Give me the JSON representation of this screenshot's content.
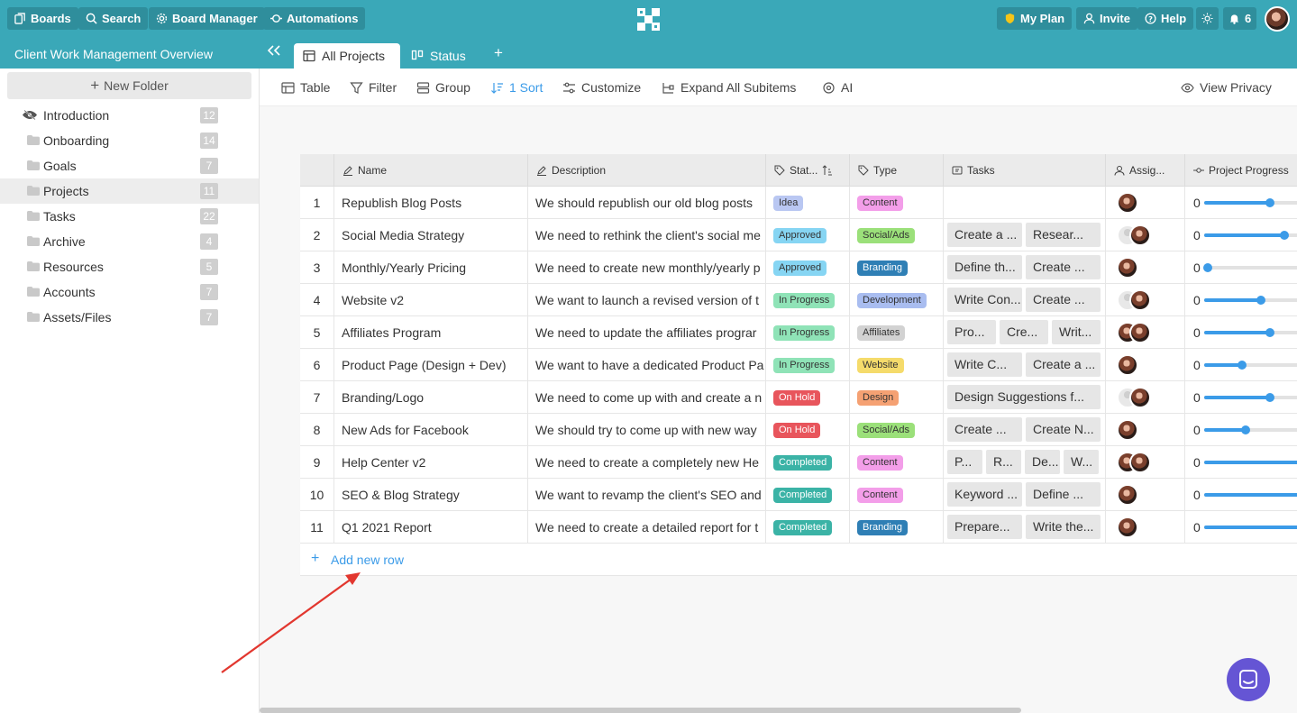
{
  "topbar": {
    "boards": "Boards",
    "search": "Search",
    "board_manager": "Board Manager",
    "automations": "Automations",
    "my_plan": "My Plan",
    "invite": "Invite",
    "help": "Help",
    "notifications": "6",
    "colors": {
      "bar": "#3aa8b8",
      "button": "#2f8e9c",
      "plan_shield": "#f5c518"
    }
  },
  "workspace": {
    "title": "Client Work Management Overview",
    "tabs": [
      {
        "label": "All Projects",
        "icon": "table-icon",
        "active": true
      },
      {
        "label": "Status",
        "icon": "kanban-icon",
        "active": false
      }
    ]
  },
  "sidebar": {
    "new_folder": "New Folder",
    "folders": [
      {
        "label": "Introduction",
        "count": "12",
        "icon": "hidden-eye-icon"
      },
      {
        "label": "Onboarding",
        "count": "14",
        "icon": "folder-icon"
      },
      {
        "label": "Goals",
        "count": "7",
        "icon": "folder-icon"
      },
      {
        "label": "Projects",
        "count": "11",
        "icon": "folder-icon",
        "selected": true
      },
      {
        "label": "Tasks",
        "count": "22",
        "icon": "folder-icon"
      },
      {
        "label": "Archive",
        "count": "4",
        "icon": "folder-icon"
      },
      {
        "label": "Resources",
        "count": "5",
        "icon": "folder-icon"
      },
      {
        "label": "Accounts",
        "count": "7",
        "icon": "folder-icon"
      },
      {
        "label": "Assets/Files",
        "count": "7",
        "icon": "folder-icon"
      }
    ]
  },
  "toolbar": {
    "table": "Table",
    "filter": "Filter",
    "group": "Group",
    "sort": "1 Sort",
    "customize": "Customize",
    "expand": "Expand All Subitems",
    "ai": "AI",
    "view_privacy": "View Privacy"
  },
  "table": {
    "headers": {
      "name": "Name",
      "description": "Description",
      "status": "Stat...",
      "type": "Type",
      "tasks": "Tasks",
      "assignee": "Assig...",
      "progress": "Project Progress"
    },
    "rows": [
      {
        "num": "1",
        "name": "Republish Blog Posts",
        "desc": "We should republish our old blog posts",
        "status": "Idea",
        "type": "Content",
        "tasks": [],
        "avatars": [
          "photo"
        ],
        "progress_text": "0",
        "progress": 0.66
      },
      {
        "num": "2",
        "name": "Social Media Strategy",
        "desc": "We need to rethink the client's social me",
        "status": "Approved",
        "type": "Social/Ads",
        "tasks": [
          "Create a ...",
          "Resear..."
        ],
        "avatars": [
          "ghost",
          "photo"
        ],
        "progress_text": "0",
        "progress": 0.81
      },
      {
        "num": "3",
        "name": "Monthly/Yearly Pricing",
        "desc": "We need to create new monthly/yearly p",
        "status": "Approved",
        "type": "Branding",
        "tasks": [
          "Define th...",
          "Create ..."
        ],
        "avatars": [
          "photo"
        ],
        "progress_text": "0",
        "progress": 0.04
      },
      {
        "num": "4",
        "name": "Website v2",
        "desc": "We want to launch a revised version of t",
        "status": "In Progress",
        "type": "Development",
        "tasks": [
          "Write Con...",
          "Create ..."
        ],
        "avatars": [
          "ghost",
          "photo"
        ],
        "progress_text": "0",
        "progress": 0.57
      },
      {
        "num": "5",
        "name": "Affiliates Program",
        "desc": "We need to update the affiliates prograr",
        "status": "In Progress",
        "type": "Affiliates",
        "tasks": [
          "Pro...",
          "Cre...",
          "Writ..."
        ],
        "avatars": [
          "photo",
          "photo"
        ],
        "progress_text": "0",
        "progress": 0.66
      },
      {
        "num": "6",
        "name": "Product Page (Design + Dev)",
        "desc": "We want to have a dedicated Product Pa",
        "status": "In Progress",
        "type": "Website",
        "tasks": [
          "Write C...",
          "Create a ..."
        ],
        "avatars": [
          "photo"
        ],
        "progress_text": "0",
        "progress": 0.38
      },
      {
        "num": "7",
        "name": "Branding/Logo",
        "desc": "We need to come up with and create a n",
        "status": "On Hold",
        "type": "Design",
        "tasks": [
          "Design Suggestions f..."
        ],
        "avatars": [
          "ghost",
          "photo"
        ],
        "progress_text": "0",
        "progress": 0.66
      },
      {
        "num": "8",
        "name": "New Ads for Facebook",
        "desc": "We should try to come up with new way",
        "status": "On Hold",
        "type": "Social/Ads",
        "tasks": [
          "Create ...",
          "Create N..."
        ],
        "avatars": [
          "photo"
        ],
        "progress_text": "0",
        "progress": 0.42
      },
      {
        "num": "9",
        "name": "Help Center v2",
        "desc": "We need to create a completely new He",
        "status": "Completed",
        "type": "Content",
        "tasks": [
          "P...",
          "R...",
          "De...",
          "W..."
        ],
        "avatars": [
          "photo",
          "photo"
        ],
        "progress_text": "0",
        "progress": 1.0
      },
      {
        "num": "10",
        "name": "SEO & Blog Strategy",
        "desc": "We want to revamp the client's SEO and",
        "status": "Completed",
        "type": "Content",
        "tasks": [
          "Keyword ...",
          "Define ..."
        ],
        "avatars": [
          "photo"
        ],
        "progress_text": "0",
        "progress": 1.0
      },
      {
        "num": "11",
        "name": "Q1 2021 Report",
        "desc": "We need to create a detailed report for t",
        "status": "Completed",
        "type": "Branding",
        "tasks": [
          "Prepare...",
          "Write the..."
        ],
        "avatars": [
          "photo"
        ],
        "progress_text": "0",
        "progress": 1.0
      }
    ],
    "add_row": "Add new row"
  },
  "status_colors": {
    "Idea": {
      "bg": "#b9c7f2",
      "fg": "#333"
    },
    "Approved": {
      "bg": "#86d5f3",
      "fg": "#333"
    },
    "In Progress": {
      "bg": "#8fe3b7",
      "fg": "#333"
    },
    "On Hold": {
      "bg": "#e8555c",
      "fg": "#fff"
    },
    "Completed": {
      "bg": "#3bb3a6",
      "fg": "#fff"
    }
  },
  "type_colors": {
    "Content": {
      "bg": "#f39ee9",
      "fg": "#333"
    },
    "Social/Ads": {
      "bg": "#9be07a",
      "fg": "#333"
    },
    "Branding": {
      "bg": "#2f7fb5",
      "fg": "#fff"
    },
    "Development": {
      "bg": "#a9bdf0",
      "fg": "#333"
    },
    "Affiliates": {
      "bg": "#d2d2d2",
      "fg": "#333"
    },
    "Website": {
      "bg": "#f5db6b",
      "fg": "#333"
    },
    "Design": {
      "bg": "#f5a173",
      "fg": "#333"
    }
  },
  "accent": "#3b9be8"
}
